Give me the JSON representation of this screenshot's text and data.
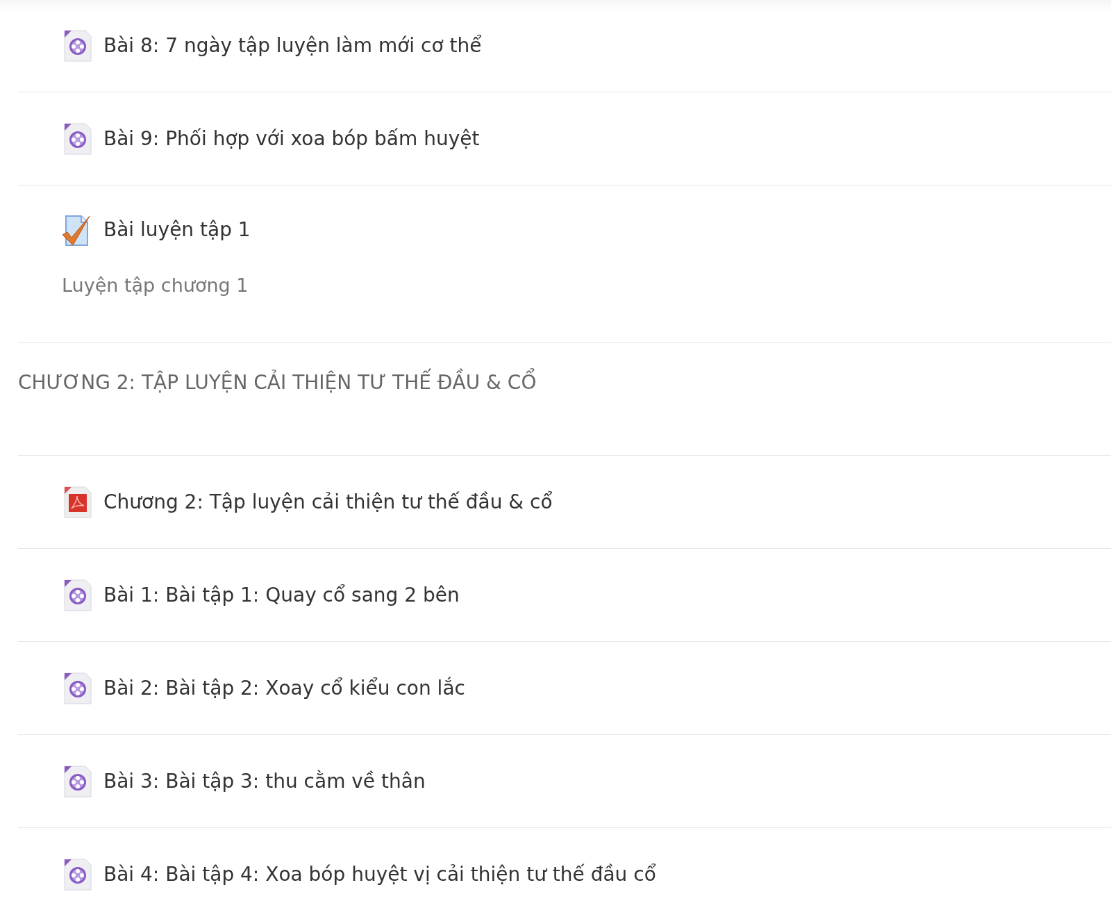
{
  "sections": [
    {
      "items": [
        {
          "kind": "video",
          "title": "Bài 8: 7 ngày tập luyện làm mới cơ thể"
        },
        {
          "kind": "video",
          "title": "Bài 9: Phối hợp với xoa bóp bấm huyệt"
        },
        {
          "kind": "quiz",
          "title": "Bài luyện tập 1",
          "description": "Luyện tập chương 1"
        }
      ]
    },
    {
      "title": "CHƯƠNG 2: TẬP LUYỆN CẢI THIỆN TƯ THẾ ĐẦU & CỔ",
      "items": [
        {
          "kind": "pdf",
          "title": "Chương 2: Tập luyện cải thiện tư thế đầu & cổ"
        },
        {
          "kind": "video",
          "title": "Bài 1: Bài tập 1: Quay cổ sang 2 bên"
        },
        {
          "kind": "video",
          "title": "Bài 2: Bài tập 2: Xoay cổ kiểu con lắc"
        },
        {
          "kind": "video",
          "title": "Bài 3: Bài tập 3: thu cằm về thân"
        },
        {
          "kind": "video",
          "title": "Bài 4: Bài tập 4: Xoa bóp huyệt vị cải thiện tư thế đầu cổ"
        }
      ]
    }
  ]
}
